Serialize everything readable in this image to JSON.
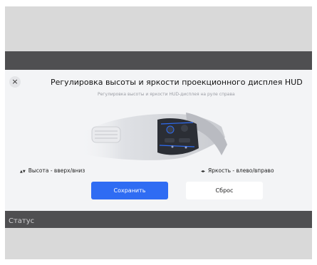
{
  "dialog": {
    "close_icon": "×",
    "title": "Регулировка высоты и яркости проекционного дисплея HUD",
    "subtitle": "Регулировка высоты и яркости HUD-дисплея на руле справа",
    "left_control": {
      "icon": "up-down-arrow-icon",
      "arrow": "▲▼",
      "label": "Высота - вверх/вниз"
    },
    "right_control": {
      "icon": "left-right-arrow-icon",
      "arrow": "◂▸",
      "label": "Яркость - влево/вправо"
    },
    "save_label": "Сохранить",
    "reset_label": "Сброс"
  },
  "status_label": "Статус",
  "colors": {
    "accent": "#2f6cf3",
    "backdrop": "#d9d9d9",
    "band": "#4f4f51",
    "dialog_bg": "#f3f4f6"
  }
}
